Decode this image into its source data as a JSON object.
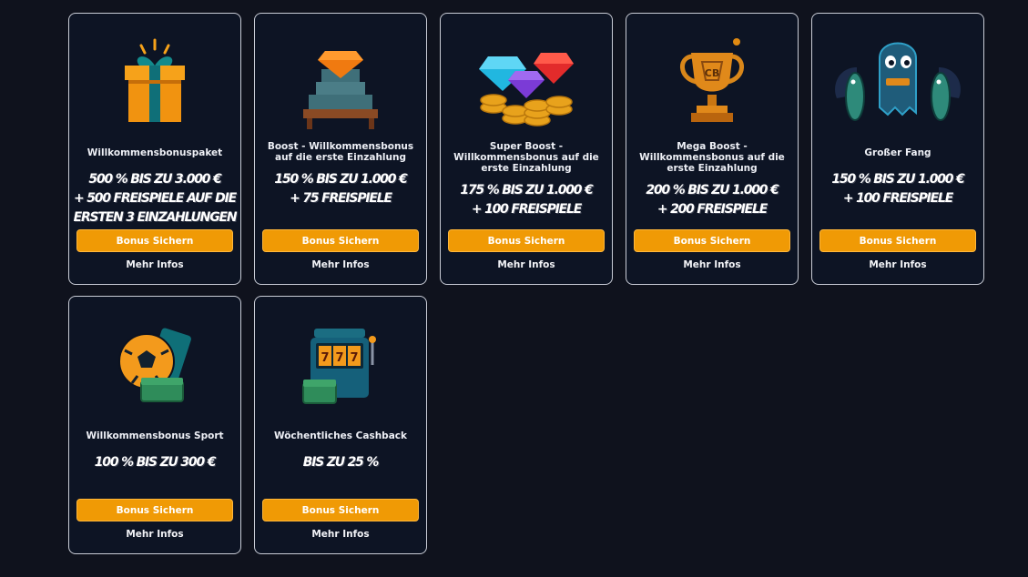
{
  "colors": {
    "background": "#0f121d",
    "card": "#0d1424",
    "card_border": "#c9ccd6",
    "accent_button": "#f09a05"
  },
  "offers": [
    {
      "title": "Willkommensbonuspaket",
      "amount_lines": [
        "500 % BIS ZU 3.000 €",
        "+ 500 FREISPIELE AUF DIE",
        "ERSTEN 3 EINZAHLUNGEN"
      ],
      "button_label": "Bonus Sichern",
      "more_label": "Mehr Infos",
      "icon": "gift-box-icon"
    },
    {
      "title": "Boost - Willkommensbonus auf die erste Einzahlung",
      "amount_lines": [
        "150 % BIS ZU 1.000 €",
        "+ 75 FREISPIELE"
      ],
      "button_label": "Bonus Sichern",
      "more_label": "Mehr Infos",
      "icon": "diamond-on-money-icon"
    },
    {
      "title": "Super Boost - Willkommensbonus auf die erste Einzahlung",
      "amount_lines": [
        "175 % BIS ZU 1.000 €",
        "+ 100 FREISPIELE"
      ],
      "button_label": "Bonus Sichern",
      "more_label": "Mehr Infos",
      "icon": "gems-and-coins-icon"
    },
    {
      "title": "Mega Boost - Willkommensbonus auf die erste Einzahlung",
      "amount_lines": [
        "200 % BIS ZU 1.000 €",
        "+ 200 FREISPIELE"
      ],
      "button_label": "Bonus Sichern",
      "more_label": "Mehr Infos",
      "icon": "trophy-icon"
    },
    {
      "title": "Großer Fang",
      "amount_lines": [
        "150 % BIS ZU 1.000 €",
        "+ 100 FREISPIELE"
      ],
      "button_label": "Bonus Sichern",
      "more_label": "Mehr Infos",
      "icon": "ghost-mascot-with-fish-icon"
    },
    {
      "title": "Willkommensbonus Sport",
      "amount_lines": [
        "100 % BIS ZU 300 €"
      ],
      "button_label": "Bonus Sichern",
      "more_label": "Mehr Infos",
      "icon": "football-ticket-icon"
    },
    {
      "title": "Wöchentliches Cashback",
      "amount_lines": [
        "BIS ZU 25 %"
      ],
      "button_label": "Bonus Sichern",
      "more_label": "Mehr Infos",
      "icon": "slot-machine-icon"
    }
  ]
}
